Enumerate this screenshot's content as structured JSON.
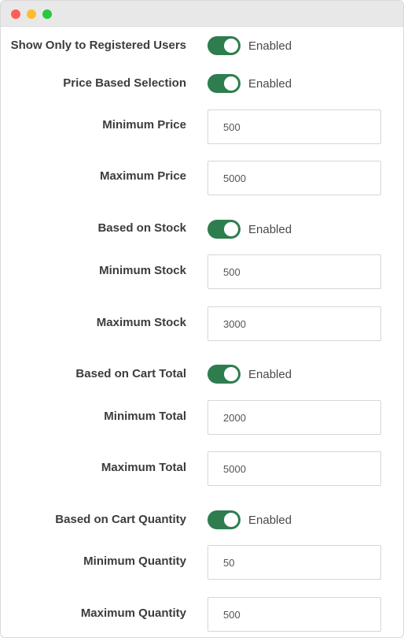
{
  "colors": {
    "toggle_on": "#2e7d4f",
    "dot_red": "#ff5f57",
    "dot_yellow": "#febc2e",
    "dot_green": "#28c840"
  },
  "settings": {
    "registered_only": {
      "label": "Show Only to Registered Users",
      "status": "Enabled",
      "on": true
    },
    "price_based": {
      "label": "Price Based Selection",
      "status": "Enabled",
      "on": true
    },
    "min_price": {
      "label": "Minimum Price",
      "value": "500"
    },
    "max_price": {
      "label": "Maximum Price",
      "value": "5000"
    },
    "stock_based": {
      "label": "Based on Stock",
      "status": "Enabled",
      "on": true
    },
    "min_stock": {
      "label": "Minimum Stock",
      "value": "500"
    },
    "max_stock": {
      "label": "Maximum Stock",
      "value": "3000"
    },
    "cart_total_based": {
      "label": "Based on Cart Total",
      "status": "Enabled",
      "on": true
    },
    "min_total": {
      "label": "Minimum Total",
      "value": "2000"
    },
    "max_total": {
      "label": "Maximum Total",
      "value": "5000"
    },
    "cart_qty_based": {
      "label": "Based on Cart Quantity",
      "status": "Enabled",
      "on": true
    },
    "min_qty": {
      "label": "Minimum Quantity",
      "value": "50"
    },
    "max_qty": {
      "label": "Maximum Quantity",
      "value": "500"
    }
  }
}
